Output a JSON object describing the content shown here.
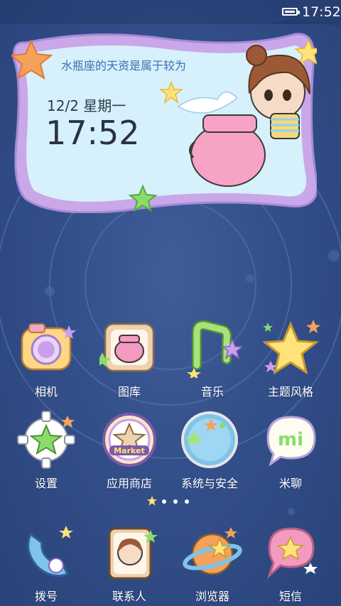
{
  "status_bar": {
    "time": "17:52"
  },
  "widget": {
    "quote": "水瓶座的天资是属于较为",
    "date": "12/2 星期一",
    "time": "17:52"
  },
  "apps": [
    {
      "label": "相机"
    },
    {
      "label": "图库"
    },
    {
      "label": "音乐"
    },
    {
      "label": "主题风格"
    },
    {
      "label": "设置"
    },
    {
      "label": "应用商店",
      "badge": "Market"
    },
    {
      "label": "系统与安全"
    },
    {
      "label": "米聊",
      "badge": "mi"
    }
  ],
  "dock": [
    {
      "label": "拨号"
    },
    {
      "label": "联系人"
    },
    {
      "label": "浏览器"
    },
    {
      "label": "短信"
    }
  ],
  "page_indicator": {
    "total": 4,
    "current": 1
  }
}
